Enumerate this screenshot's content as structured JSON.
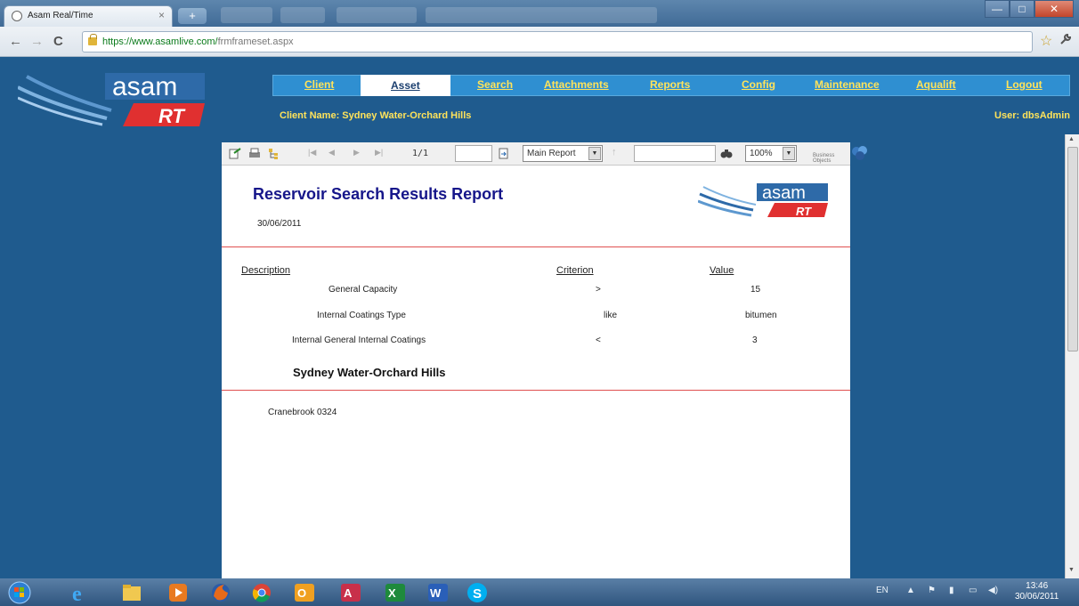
{
  "browser": {
    "tab_title": "Asam Real/Time",
    "tab_close": "×",
    "new_tab": "+",
    "url_scheme_host": "https://www.asamlive.com/",
    "url_path": "frmframeset.aspx",
    "nav_back": "←",
    "nav_forward": "→",
    "nav_reload": "C",
    "star": "☆",
    "wrench": "🔧",
    "win_min": "—",
    "win_max": "□",
    "win_close": "✕"
  },
  "app": {
    "menu": [
      {
        "label": "Client"
      },
      {
        "label": "Asset"
      },
      {
        "label": "Search"
      },
      {
        "label": "Attachments"
      },
      {
        "label": "Reports"
      },
      {
        "label": "Config"
      },
      {
        "label": "Maintenance"
      },
      {
        "label": "Aqualift"
      },
      {
        "label": "Logout"
      }
    ],
    "active_menu": "Asset",
    "client_name": "Client Name: Sydney Water-Orchard Hills",
    "user": "User: dbsAdmin",
    "logo_text": "asam",
    "logo_sub": "RT"
  },
  "viewer": {
    "page_indicator": "1/1",
    "report_select": "Main Report",
    "zoom": "100%",
    "business_objects": "Business Objects"
  },
  "report": {
    "title": "Reservoir Search Results Report",
    "date": "30/06/2011",
    "columns": [
      "Description",
      "Criterion",
      "Value"
    ],
    "rows": [
      {
        "description": "General Capacity",
        "criterion": ">",
        "value": "15"
      },
      {
        "description": "Internal Coatings Type",
        "criterion": "like",
        "value": "bitumen"
      },
      {
        "description": "Internal General Internal Coatings",
        "criterion": "<",
        "value": "3"
      }
    ],
    "client_heading": "Sydney Water-Orchard Hills",
    "site": "Cranebrook 0324"
  },
  "taskbar": {
    "lang": "EN",
    "time": "13:46",
    "date": "30/06/2011"
  },
  "colors": {
    "app_background": "#1f5b8e",
    "menu_background": "#2f8fd1",
    "menu_text": "#ffe35a",
    "report_title": "#16168a",
    "report_rule": "#e05050"
  }
}
